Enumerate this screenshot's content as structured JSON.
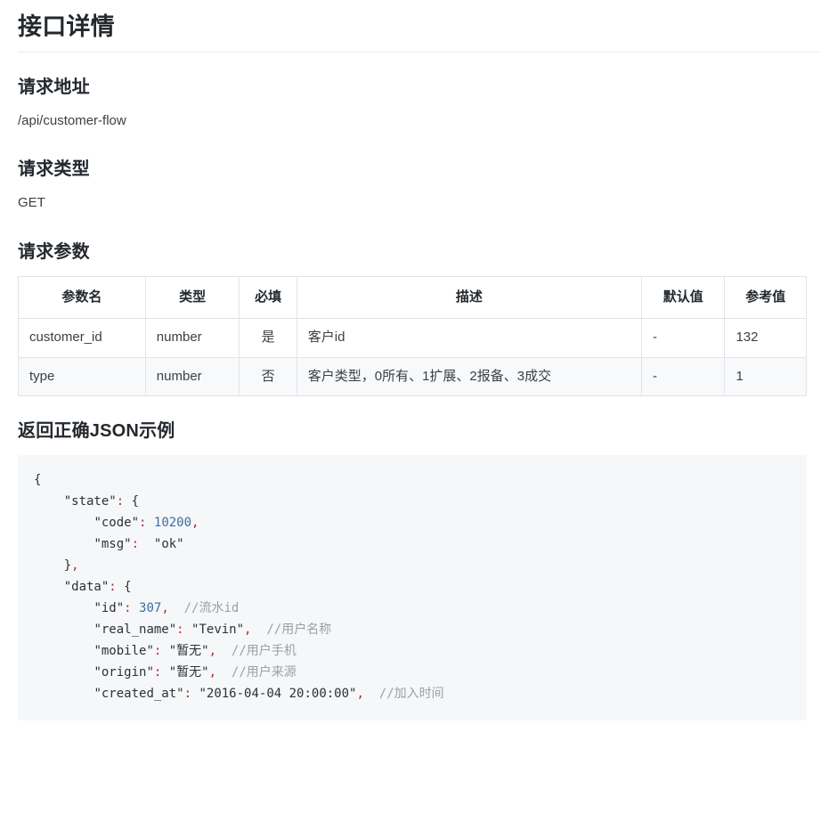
{
  "page": {
    "title": "接口详情"
  },
  "sections": {
    "request_url": {
      "heading": "请求地址",
      "value": "/api/customer-flow"
    },
    "request_type": {
      "heading": "请求类型",
      "value": "GET"
    },
    "request_params": {
      "heading": "请求参数"
    },
    "response_example": {
      "heading": "返回正确JSON示例"
    }
  },
  "params_table": {
    "headers": {
      "name": "参数名",
      "type": "类型",
      "required": "必填",
      "description": "描述",
      "default_value": "默认值",
      "reference_value": "参考值"
    },
    "rows": [
      {
        "name": "customer_id",
        "type": "number",
        "required": "是",
        "description": "客户id",
        "default_value": "-",
        "reference_value": "132"
      },
      {
        "name": "type",
        "type": "number",
        "required": "否",
        "description": "客户类型，0所有、1扩展、2报备、3成交",
        "default_value": "-",
        "reference_value": "1"
      }
    ]
  },
  "code_sample": {
    "lines": [
      [
        {
          "t": "{",
          "c": "brace"
        }
      ],
      [
        {
          "t": "    ",
          "c": "plain"
        },
        {
          "t": "\"state\"",
          "c": "key"
        },
        {
          "t": ":",
          "c": "punc"
        },
        {
          "t": " ",
          "c": "plain"
        },
        {
          "t": "{",
          "c": "brace"
        }
      ],
      [
        {
          "t": "        ",
          "c": "plain"
        },
        {
          "t": "\"code\"",
          "c": "key"
        },
        {
          "t": ":",
          "c": "punc"
        },
        {
          "t": " ",
          "c": "plain"
        },
        {
          "t": "10200",
          "c": "num"
        },
        {
          "t": ",",
          "c": "punc"
        }
      ],
      [
        {
          "t": "        ",
          "c": "plain"
        },
        {
          "t": "\"msg\"",
          "c": "key"
        },
        {
          "t": ":",
          "c": "punc"
        },
        {
          "t": "  ",
          "c": "plain"
        },
        {
          "t": "\"ok\"",
          "c": "str"
        }
      ],
      [
        {
          "t": "    ",
          "c": "plain"
        },
        {
          "t": "}",
          "c": "brace"
        },
        {
          "t": ",",
          "c": "punc"
        }
      ],
      [
        {
          "t": "    ",
          "c": "plain"
        },
        {
          "t": "\"data\"",
          "c": "key"
        },
        {
          "t": ":",
          "c": "punc"
        },
        {
          "t": " ",
          "c": "plain"
        },
        {
          "t": "{",
          "c": "brace"
        }
      ],
      [
        {
          "t": "        ",
          "c": "plain"
        },
        {
          "t": "\"id\"",
          "c": "key"
        },
        {
          "t": ":",
          "c": "punc"
        },
        {
          "t": " ",
          "c": "plain"
        },
        {
          "t": "307",
          "c": "num"
        },
        {
          "t": ",",
          "c": "punc"
        },
        {
          "t": "  ",
          "c": "plain"
        },
        {
          "t": "//流水id",
          "c": "com"
        }
      ],
      [
        {
          "t": "        ",
          "c": "plain"
        },
        {
          "t": "\"real_name\"",
          "c": "key"
        },
        {
          "t": ":",
          "c": "punc"
        },
        {
          "t": " ",
          "c": "plain"
        },
        {
          "t": "\"Tevin\"",
          "c": "str"
        },
        {
          "t": ",",
          "c": "punc"
        },
        {
          "t": "  ",
          "c": "plain"
        },
        {
          "t": "//用户名称",
          "c": "com"
        }
      ],
      [
        {
          "t": "        ",
          "c": "plain"
        },
        {
          "t": "\"mobile\"",
          "c": "key"
        },
        {
          "t": ":",
          "c": "punc"
        },
        {
          "t": " ",
          "c": "plain"
        },
        {
          "t": "\"暂无\"",
          "c": "str"
        },
        {
          "t": ",",
          "c": "punc"
        },
        {
          "t": "  ",
          "c": "plain"
        },
        {
          "t": "//用户手机",
          "c": "com"
        }
      ],
      [
        {
          "t": "        ",
          "c": "plain"
        },
        {
          "t": "\"origin\"",
          "c": "key"
        },
        {
          "t": ":",
          "c": "punc"
        },
        {
          "t": " ",
          "c": "plain"
        },
        {
          "t": "\"暂无\"",
          "c": "str"
        },
        {
          "t": ",",
          "c": "punc"
        },
        {
          "t": "  ",
          "c": "plain"
        },
        {
          "t": "//用户来源",
          "c": "com"
        }
      ],
      [
        {
          "t": "        ",
          "c": "plain"
        },
        {
          "t": "\"created_at\"",
          "c": "key"
        },
        {
          "t": ":",
          "c": "punc"
        },
        {
          "t": " ",
          "c": "plain"
        },
        {
          "t": "\"2016-04-04 20:00:00\"",
          "c": "str"
        },
        {
          "t": ",",
          "c": "punc"
        },
        {
          "t": "  ",
          "c": "plain"
        },
        {
          "t": "//加入时间",
          "c": "com"
        }
      ]
    ]
  }
}
